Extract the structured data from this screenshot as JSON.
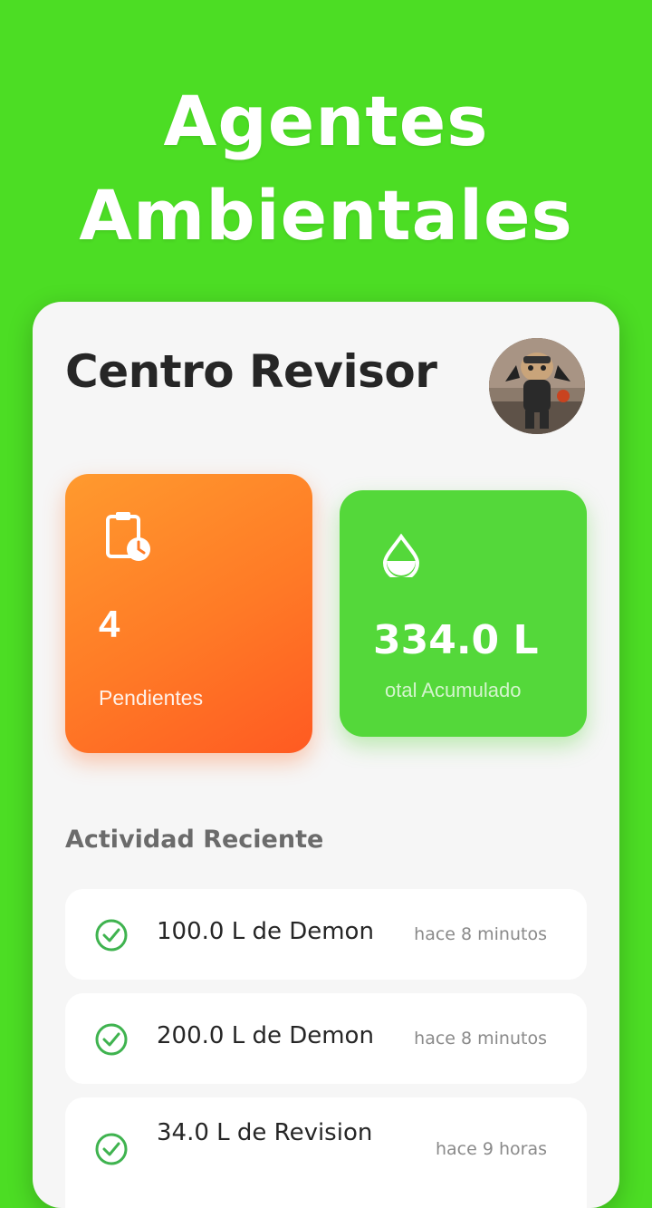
{
  "headline": {
    "line1": "Agentes",
    "line2": "Ambientales"
  },
  "screen": {
    "title": "Centro Revisor",
    "stats": [
      {
        "value": "4",
        "label": "Pendientes",
        "icon": "clipboard-clock-icon",
        "color": "#ff7a26"
      },
      {
        "value": "334.0 L",
        "label": "otal Acumulado",
        "icon": "water-drop-icon",
        "color": "#54d83a"
      }
    ],
    "section_title": "Actividad Reciente",
    "activity": [
      {
        "text": "100.0 L de Demon",
        "time": "hace 8 minutos",
        "icon": "check-circle-icon"
      },
      {
        "text": "200.0 L de Demon",
        "time": "hace 8 minutos",
        "icon": "check-circle-icon"
      },
      {
        "text": "34.0 L de Revision",
        "time": "hace 9 horas",
        "icon": "check-circle-icon"
      }
    ]
  },
  "colors": {
    "background": "#4cdd24",
    "accent_orange": "#ff7a26",
    "accent_green": "#54d83a",
    "check_green": "#3fb34f"
  }
}
